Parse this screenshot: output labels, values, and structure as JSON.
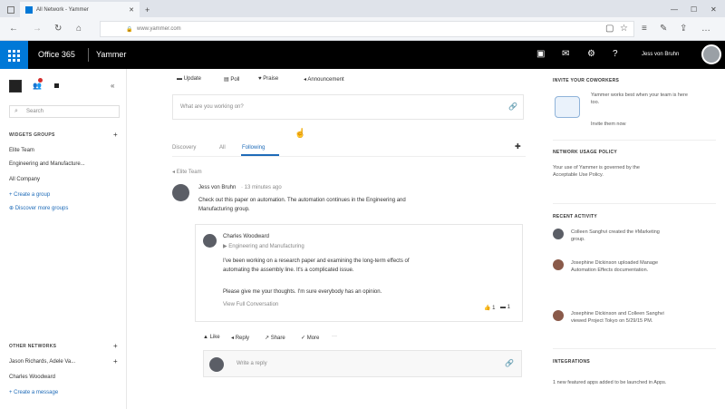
{
  "browser": {
    "tab_title": "All Network - Yammer",
    "url": "www.yammer.com"
  },
  "suite": {
    "app_name": "Office 365",
    "product": "Yammer",
    "user_name": "Jess von Bruhn"
  },
  "sidebar": {
    "search_placeholder": "Search",
    "groups_heading": "WIDGETS GROUPS",
    "groups": [
      "Elite Team",
      "Engineering and Manufacture...",
      "All Company"
    ],
    "create_group": "+ Create a group",
    "discover_groups": "⊕ Discover more groups",
    "inbox_heading": "OTHER NETWORKS",
    "inbox_items": [
      "Jason Richards, Adele Va...",
      "Charles Woodward"
    ],
    "create_message": "+ Create a message"
  },
  "publisher": {
    "tabs": [
      "Update",
      "Poll",
      "Praise",
      "Announcement"
    ],
    "placeholder": "What are you working on?"
  },
  "feed_tabs": [
    "Discovery",
    "All",
    "Following"
  ],
  "post": {
    "group": "Elite Team",
    "author": "Jess von Bruhn",
    "time": "· 13 minutes ago",
    "body_1": "Check out this paper on automation. The automation continues in the Engineering and",
    "body_2": "Manufacturing group.",
    "shared_author": "Charles Woodward",
    "shared_group": "▶ Engineering and Manufacturing",
    "shared_body_1": "I've been working on a research paper and examining the long-term effects of",
    "shared_body_2": "automating the assembly line. It's a complicated issue.",
    "shared_body_3": "Please give me your thoughts. I'm sure everybody has an opinion.",
    "shared_link": "View Full Conversation",
    "shared_likes": "1",
    "shared_replies": "1",
    "actions": [
      "Like",
      "Reply",
      "Share",
      "More"
    ],
    "reply_placeholder": "Write a reply"
  },
  "right": {
    "conversations_heading": "INVITE YOUR COWORKERS",
    "conversations_text": "Yammer works best when your team is here too.",
    "conversations_link": "Invite them now",
    "policy_heading": "NETWORK USAGE POLICY",
    "policy_text": "Your use of Yammer is governed by the Acceptable Use Policy.",
    "activity_heading": "RECENT ACTIVITY",
    "activity": [
      {
        "text": "Colleen Sanghvi created the #Marketing group."
      },
      {
        "text": "Josephine Dickinson uploaded Manage Automation Effects documentation."
      },
      {
        "text": "Josephine Dickinson and Colleen Sanghvi viewed Project Tokyo on 5/29/15 PM."
      }
    ],
    "integrations_heading": "INTEGRATIONS",
    "integrations_text": "1 new featured apps added to be launched in Apps."
  },
  "colors": {
    "brand": "#0078d7",
    "suite_bg": "#000000",
    "link": "#1e6bb8"
  }
}
